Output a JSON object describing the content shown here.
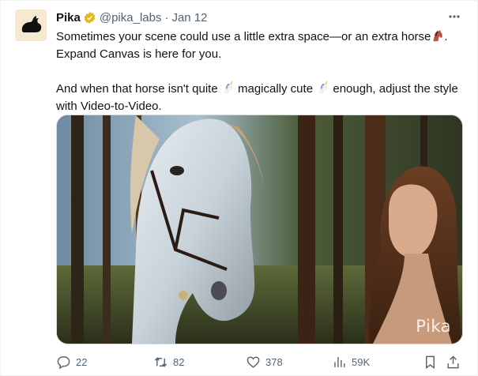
{
  "tweet": {
    "author_name": "Pika",
    "handle": "@pika_labs",
    "separator": "·",
    "date": "Jan 12",
    "paragraph1_part1": "Sometimes your scene could use a little extra space—or an extra horse",
    "paragraph1_part2": ". Expand Canvas is here for you.",
    "paragraph2_part1": "And when that horse isn't quite ",
    "paragraph2_part2": " magically cute ",
    "paragraph2_part3": " enough, adjust the style with Video-to-Video.",
    "media_watermark": "Pika"
  },
  "icons": {
    "avatar": "rabbit-logo",
    "verified": "verified-badge-icon",
    "more": "more-icon",
    "horse_emoji": "horse-emoji",
    "unicorn_emoji": "unicorn-emoji"
  },
  "actions": {
    "replies": "22",
    "retweets": "82",
    "likes": "378",
    "views": "59K"
  },
  "colors": {
    "text": "#0f1419",
    "secondary": "#536471",
    "verified_gold": "#e2b719",
    "avatar_bg": "#f6e9cf"
  }
}
